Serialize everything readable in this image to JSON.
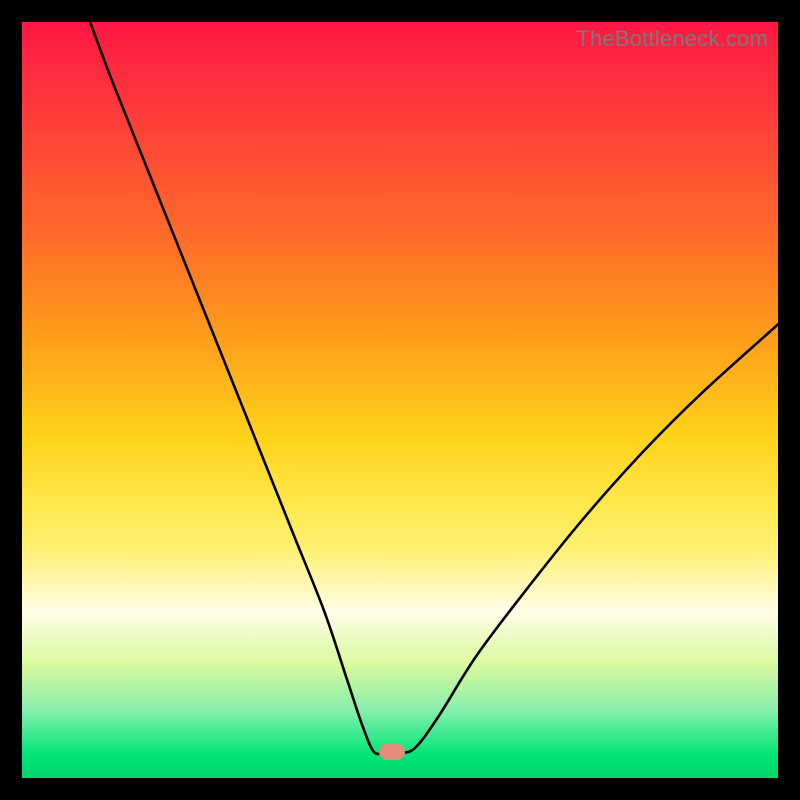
{
  "watermark": "TheBottleneck.com",
  "marker": {
    "x_pct": 49.0,
    "y_pct": 96.5
  },
  "chart_data": {
    "type": "line",
    "title": "",
    "xlabel": "",
    "ylabel": "",
    "xlim": [
      0,
      100
    ],
    "ylim": [
      0,
      100
    ],
    "grid": false,
    "legend": false,
    "series": [
      {
        "name": "bottleneck-curve",
        "x": [
          9,
          12,
          16,
          20,
          24,
          28,
          32,
          36,
          40,
          43,
          45,
          46.5,
          48,
          50,
          52,
          55,
          60,
          66,
          74,
          82,
          90,
          100
        ],
        "y": [
          100,
          92,
          82,
          72,
          62,
          52,
          42,
          32,
          22,
          13,
          7,
          3.5,
          3.3,
          3.3,
          4,
          8,
          16,
          24,
          34,
          43,
          51,
          60
        ]
      }
    ],
    "marker_point": {
      "x": 49,
      "y": 3.5
    }
  }
}
